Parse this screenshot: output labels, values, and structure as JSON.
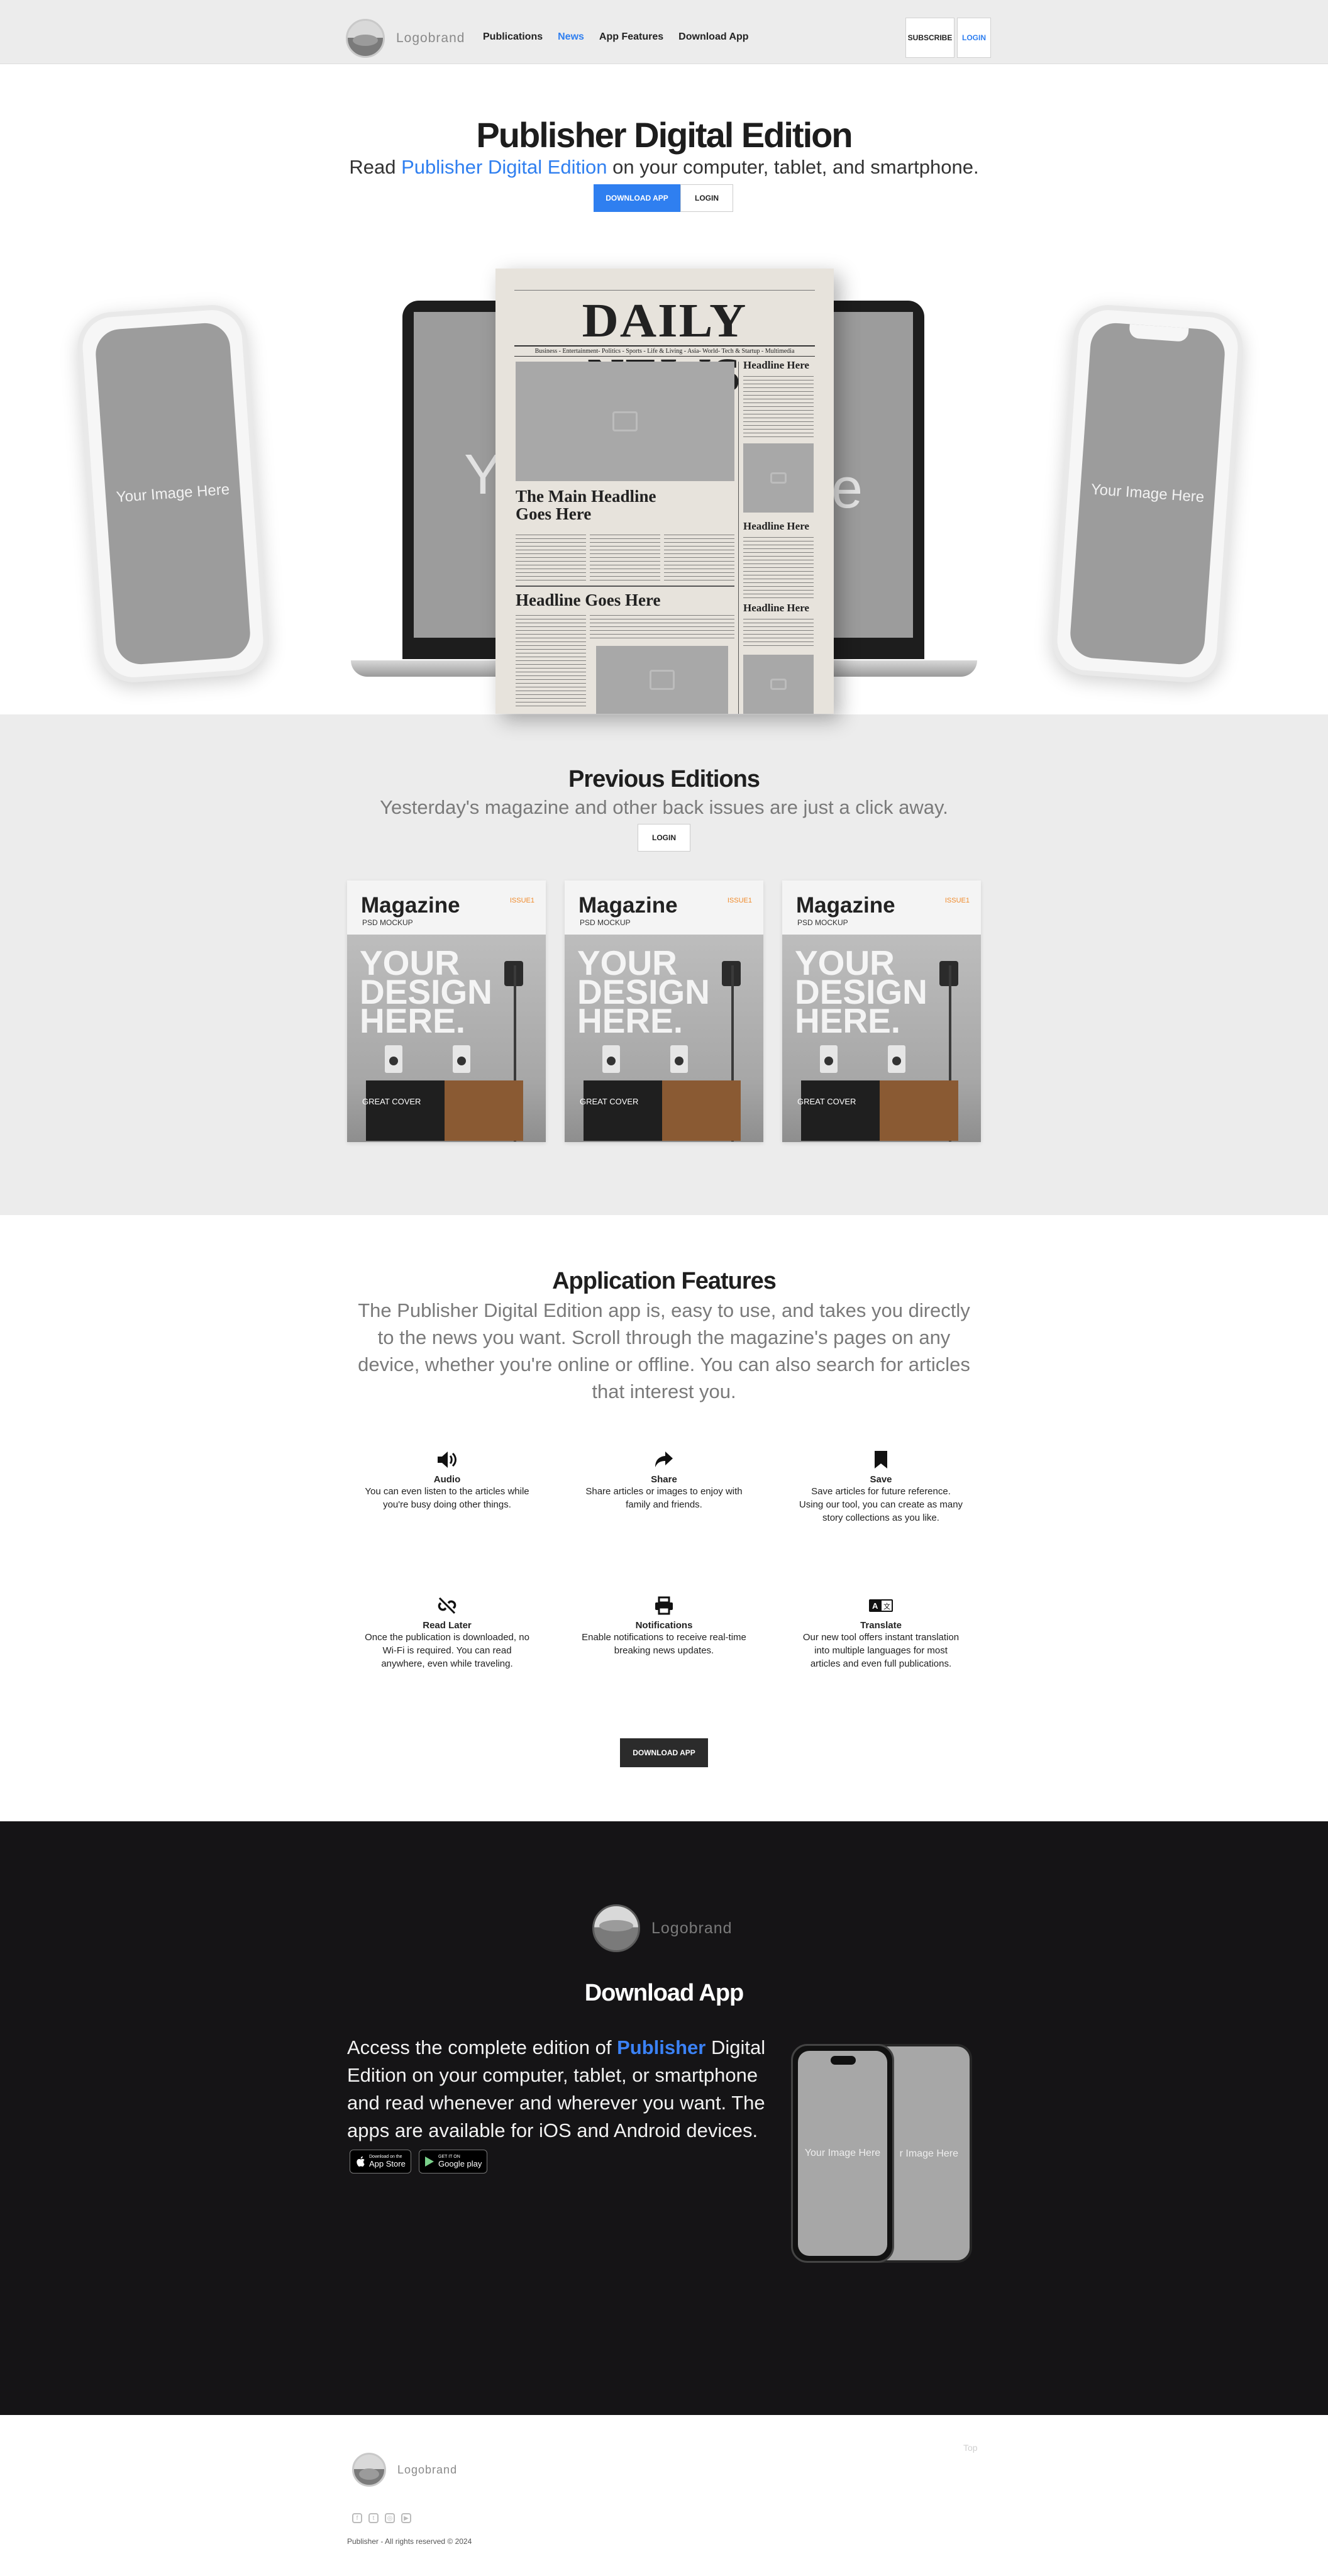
{
  "nav": {
    "logo_text": "Logobrand",
    "links": [
      "Publications",
      "News",
      "App Features",
      "Download App"
    ],
    "subscribe": "SUBSCRIBE",
    "login": "LOGIN"
  },
  "hero": {
    "title": "Publisher Digital Edition",
    "sub_before": "Read",
    "sub_highlight": "Publisher Digital Edition",
    "sub_after": "on your computer, tablet, and smartphone.",
    "download_btn": "DOWNLOAD APP",
    "login_btn": "LOGIN",
    "device_placeholder": "Your Image Here",
    "laptop_left": "Yo",
    "laptop_right": "e"
  },
  "newspaper": {
    "masthead": "DAILY NEWS",
    "sections": "Business - Entertainment- Politics - Sports - Life & Living - Asia- World- Tech & Startup - Multimedia",
    "headline_main": "The Main Headline Goes Here",
    "headline_second": "Headline Goes Here",
    "side_headline_1": "Headline Here",
    "side_headline_2": "Headline Here",
    "side_headline_3": "Headline Here"
  },
  "previous": {
    "title": "Previous Editions",
    "sub": "Yesterday's magazine and other back issues are just a click away.",
    "login_btn": "LOGIN",
    "magazines": [
      {
        "title": "Magazine",
        "sub": "PSD MOCKUP",
        "num": "ISSUE1",
        "design": "YOUR DESIGN HERE.",
        "cover": "GREAT COVER"
      },
      {
        "title": "Magazine",
        "sub": "PSD MOCKUP",
        "num": "ISSUE1",
        "design": "YOUR DESIGN HERE.",
        "cover": "GREAT COVER"
      },
      {
        "title": "Magazine",
        "sub": "PSD MOCKUP",
        "num": "ISSUE1",
        "design": "YOUR DESIGN HERE.",
        "cover": "GREAT COVER"
      }
    ]
  },
  "features": {
    "title": "Application Features",
    "sub": "The Publisher Digital Edition app is, easy to use, and takes you directly to the news you want. Scroll through the magazine's pages on any device, whether you're online or offline. You can also search for articles that interest you.",
    "items": [
      {
        "icon": "speaker-icon",
        "title": "Audio",
        "desc": "You can even listen to the articles while you're busy doing other things."
      },
      {
        "icon": "share-icon",
        "title": "Share",
        "desc": "Share articles or images to enjoy with family and friends."
      },
      {
        "icon": "bookmark-icon",
        "title": "Save",
        "desc": "Save articles for future reference. Using our tool, you can create as many story collections as you like."
      },
      {
        "icon": "unlink-icon",
        "title": "Read Later",
        "desc": "Once the publication is downloaded, no Wi-Fi is required. You can read anywhere, even while traveling."
      },
      {
        "icon": "printer-icon",
        "title": "Notifications",
        "desc": "Enable notifications to receive real-time breaking news updates."
      },
      {
        "icon": "translate-icon",
        "title": "Translate",
        "desc": "Our new tool offers instant translation into multiple languages for most articles and even full publications."
      }
    ],
    "download_btn": "DOWNLOAD APP"
  },
  "download": {
    "logo_text": "Logobrand",
    "title": "Download App",
    "text_before": "Access the complete edition of",
    "text_highlight": "Publisher",
    "text_after": "Digital Edition on your computer, tablet, or smartphone and read whenever and wherever you want. The apps are available for iOS and Android devices.",
    "appstore_small": "Download on the",
    "appstore": "App Store",
    "gplay_small": "GET IT ON",
    "gplay": "Google play",
    "phone_placeholder": "Your Image Here",
    "phone_back_placeholder": "r Image Here"
  },
  "footer": {
    "logo_text": "Logobrand",
    "top": "Top",
    "copyright": "Publisher - All rights reserved © 2024"
  },
  "colors": {
    "accent": "#2f7ff0",
    "dark": "#151416",
    "band": "#ececec"
  }
}
